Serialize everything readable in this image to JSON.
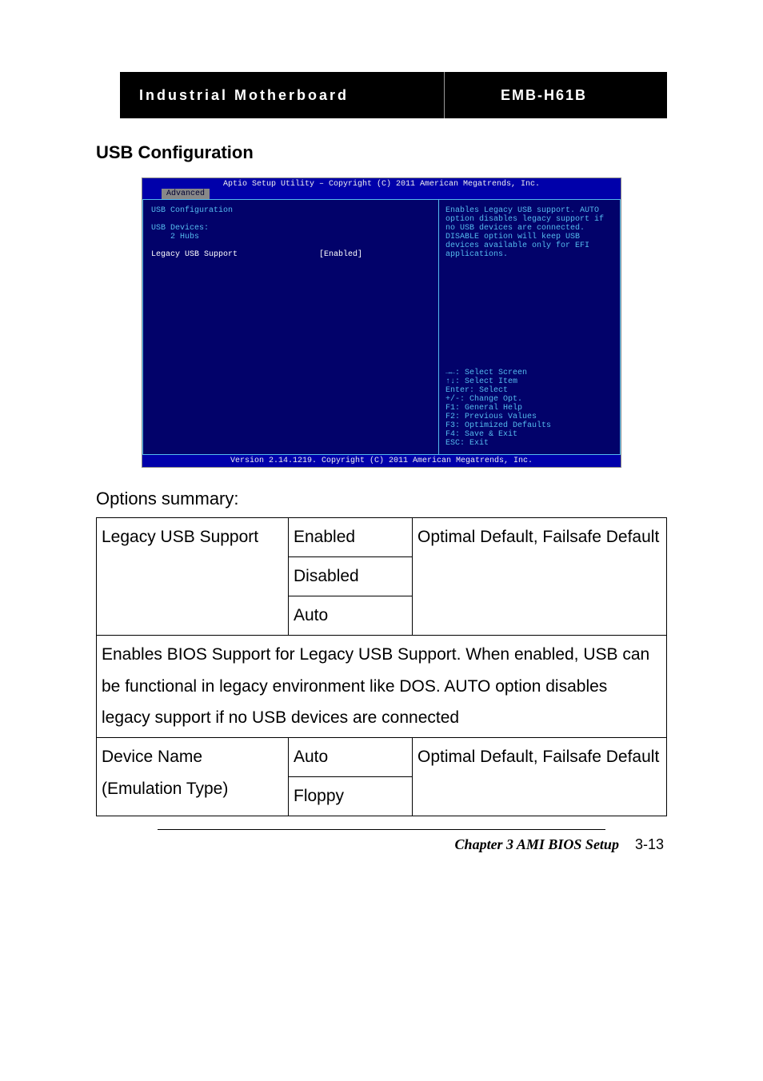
{
  "header": {
    "left": "Industrial Motherboard",
    "right": "EMB-H61B"
  },
  "section_title": "USB Configuration",
  "bios": {
    "top": "Aptio Setup Utility – Copyright (C) 2011 American Megatrends, Inc.",
    "tab": "Advanced",
    "left": {
      "title": "USB Configuration",
      "devices_label": "USB Devices:",
      "devices_value": "2 Hubs",
      "option_label": "Legacy USB Support",
      "option_value": "[Enabled]"
    },
    "help": "Enables Legacy USB support. AUTO option disables legacy support if no USB devices are connected. DISABLE option will keep USB devices available only for EFI applications.",
    "keys": [
      "→←: Select Screen",
      "↑↓: Select Item",
      "Enter: Select",
      "+/-: Change Opt.",
      "F1: General Help",
      "F2: Previous Values",
      "F3: Optimized Defaults",
      "F4: Save & Exit",
      "ESC: Exit"
    ],
    "footer": "Version 2.14.1219. Copyright (C) 2011 American Megatrends, Inc."
  },
  "options_summary_label": "Options summary:",
  "table": {
    "row1": {
      "name": "Legacy USB Support",
      "opt1": "Enabled",
      "default": "Optimal Default, Failsafe Default",
      "opt2": "Disabled",
      "opt3": "Auto"
    },
    "desc": "Enables BIOS Support for Legacy USB Support. When enabled, USB can be functional in legacy environment like DOS. AUTO option disables legacy support if no USB devices are connected",
    "row2": {
      "name1": "Device Name",
      "name2": "(Emulation Type)",
      "opt1": "Auto",
      "default": "Optimal Default, Failsafe Default",
      "opt2": "Floppy"
    }
  },
  "footer": {
    "chapter": "Chapter 3 AMI BIOS Setup",
    "page": "3-13"
  }
}
